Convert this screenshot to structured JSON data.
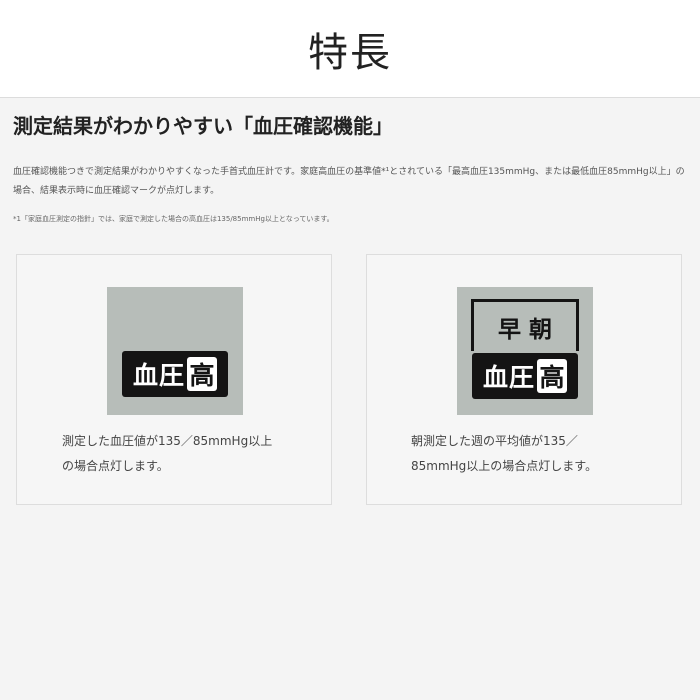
{
  "header": {
    "title": "特長"
  },
  "section": {
    "title": "測定結果がわかりやすい「血圧確認機能」",
    "description": "血圧確認機能つきで測定結果がわかりやすくなった手首式血圧計です。家庭高血圧の基準値*¹とされている「最高血圧135mmHg、または最低血圧85mmHg以上」の場合、結果表示時に血圧確認マークが点灯します。",
    "footnote": "*1「家庭血圧測定の指針」では、家庭で測定した場合の高血圧は135/85mmHg以上となっています。"
  },
  "cards": [
    {
      "lamp_text": "血圧",
      "lamp_highlight": "高",
      "caption_line1": "測定した血圧値が135／85mmHg以上",
      "caption_line2": "の場合点灯します。"
    },
    {
      "morning_label": "早朝",
      "lamp_text": "血圧",
      "lamp_highlight": "高",
      "caption_line1": "朝測定した週の平均値が135／",
      "caption_line2": "85mmHg以上の場合点灯します。"
    }
  ],
  "colors": {
    "header_bg": "#ffffff",
    "page_bg": "#f4f4f4",
    "indicator_bg": "#b7bdb9",
    "lamp_bg": "#141414"
  }
}
